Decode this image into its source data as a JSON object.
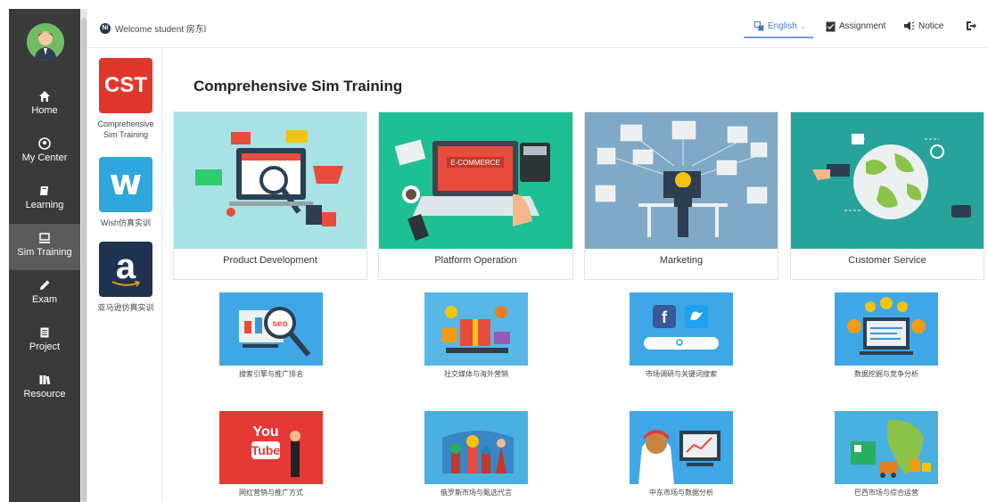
{
  "sidebar": {
    "items": [
      {
        "label": "Home",
        "icon": "home-icon"
      },
      {
        "label": "My Center",
        "icon": "user-circle-icon"
      },
      {
        "label": "Learning",
        "icon": "book-icon"
      },
      {
        "label": "Sim Training",
        "icon": "monitor-icon",
        "active": true
      },
      {
        "label": "Exam",
        "icon": "pencil-icon"
      },
      {
        "label": "Project",
        "icon": "project-icon"
      },
      {
        "label": "Resource",
        "icon": "library-icon"
      }
    ]
  },
  "header": {
    "welcome": "Welcome student 房东l",
    "language": "English",
    "assignment": "Assignment",
    "notice": "Notice"
  },
  "categories": [
    {
      "logo_text": "CST",
      "label": "Comprehensive Sim Training"
    },
    {
      "logo_text": "w",
      "label": "Wish仿真实训"
    },
    {
      "logo_text": "a",
      "label": "亚马逊仿真实训"
    }
  ],
  "main": {
    "title": "Comprehensive Sim Training",
    "modules": [
      {
        "label": "Product Development"
      },
      {
        "label": "Platform Operation"
      },
      {
        "label": "Marketing"
      },
      {
        "label": "Customer Service"
      }
    ],
    "tiles": [
      {
        "label": "搜索引擎与推广排名"
      },
      {
        "label": "社交媒体与海外营销"
      },
      {
        "label": "市场调研与关键词搜索"
      },
      {
        "label": "数据挖掘与竞争分析"
      },
      {
        "label": "网红营销与推广方式"
      },
      {
        "label": "俄罗斯市场与甄选代言"
      },
      {
        "label": "中东市场与数据分析"
      },
      {
        "label": "巴西市场与综合运营"
      }
    ]
  },
  "colors": {
    "sidebar_bg": "#3a3a3a",
    "active_item": "#5a5a5a",
    "accent": "#4a7ab8",
    "cst_red": "#e0372c",
    "wish_blue": "#2fa6dc",
    "amazon_navy": "#1f3350"
  }
}
